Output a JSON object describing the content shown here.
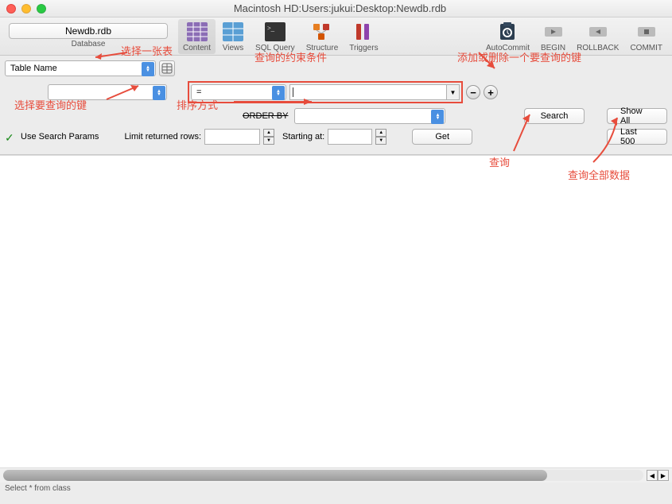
{
  "window": {
    "title": "Macintosh HD:Users:jukui:Desktop:Newdb.rdb"
  },
  "toolbar": {
    "db_button": "Newdb.rdb",
    "db_label": "Database",
    "items": [
      {
        "label": "Content"
      },
      {
        "label": "Views"
      },
      {
        "label": "SQL Query"
      },
      {
        "label": "Structure"
      },
      {
        "label": "Triggers"
      }
    ],
    "right_items": [
      {
        "label": "AutoCommit"
      },
      {
        "label": "BEGIN"
      },
      {
        "label": "ROLLBACK"
      },
      {
        "label": "COMMIT"
      }
    ]
  },
  "query": {
    "table_name_label": "Table Name",
    "operator": "=",
    "order_by": "ORDER BY",
    "search_btn": "Search",
    "show_all_btn": "Show All",
    "use_search_params": "Use Search Params",
    "limit_label": "Limit returned rows:",
    "starting_label": "Starting at:",
    "get_btn": "Get",
    "last_btn": "Last 500"
  },
  "annotations": {
    "select_table": "选择一张表",
    "select_key": "选择要查询的键",
    "constraint": "查询的约束条件",
    "sort": "排序方式",
    "add_remove": "添加或删除一个要查询的键",
    "query": "查询",
    "query_all": "查询全部数据"
  },
  "status": {
    "text": "Select * from class"
  }
}
